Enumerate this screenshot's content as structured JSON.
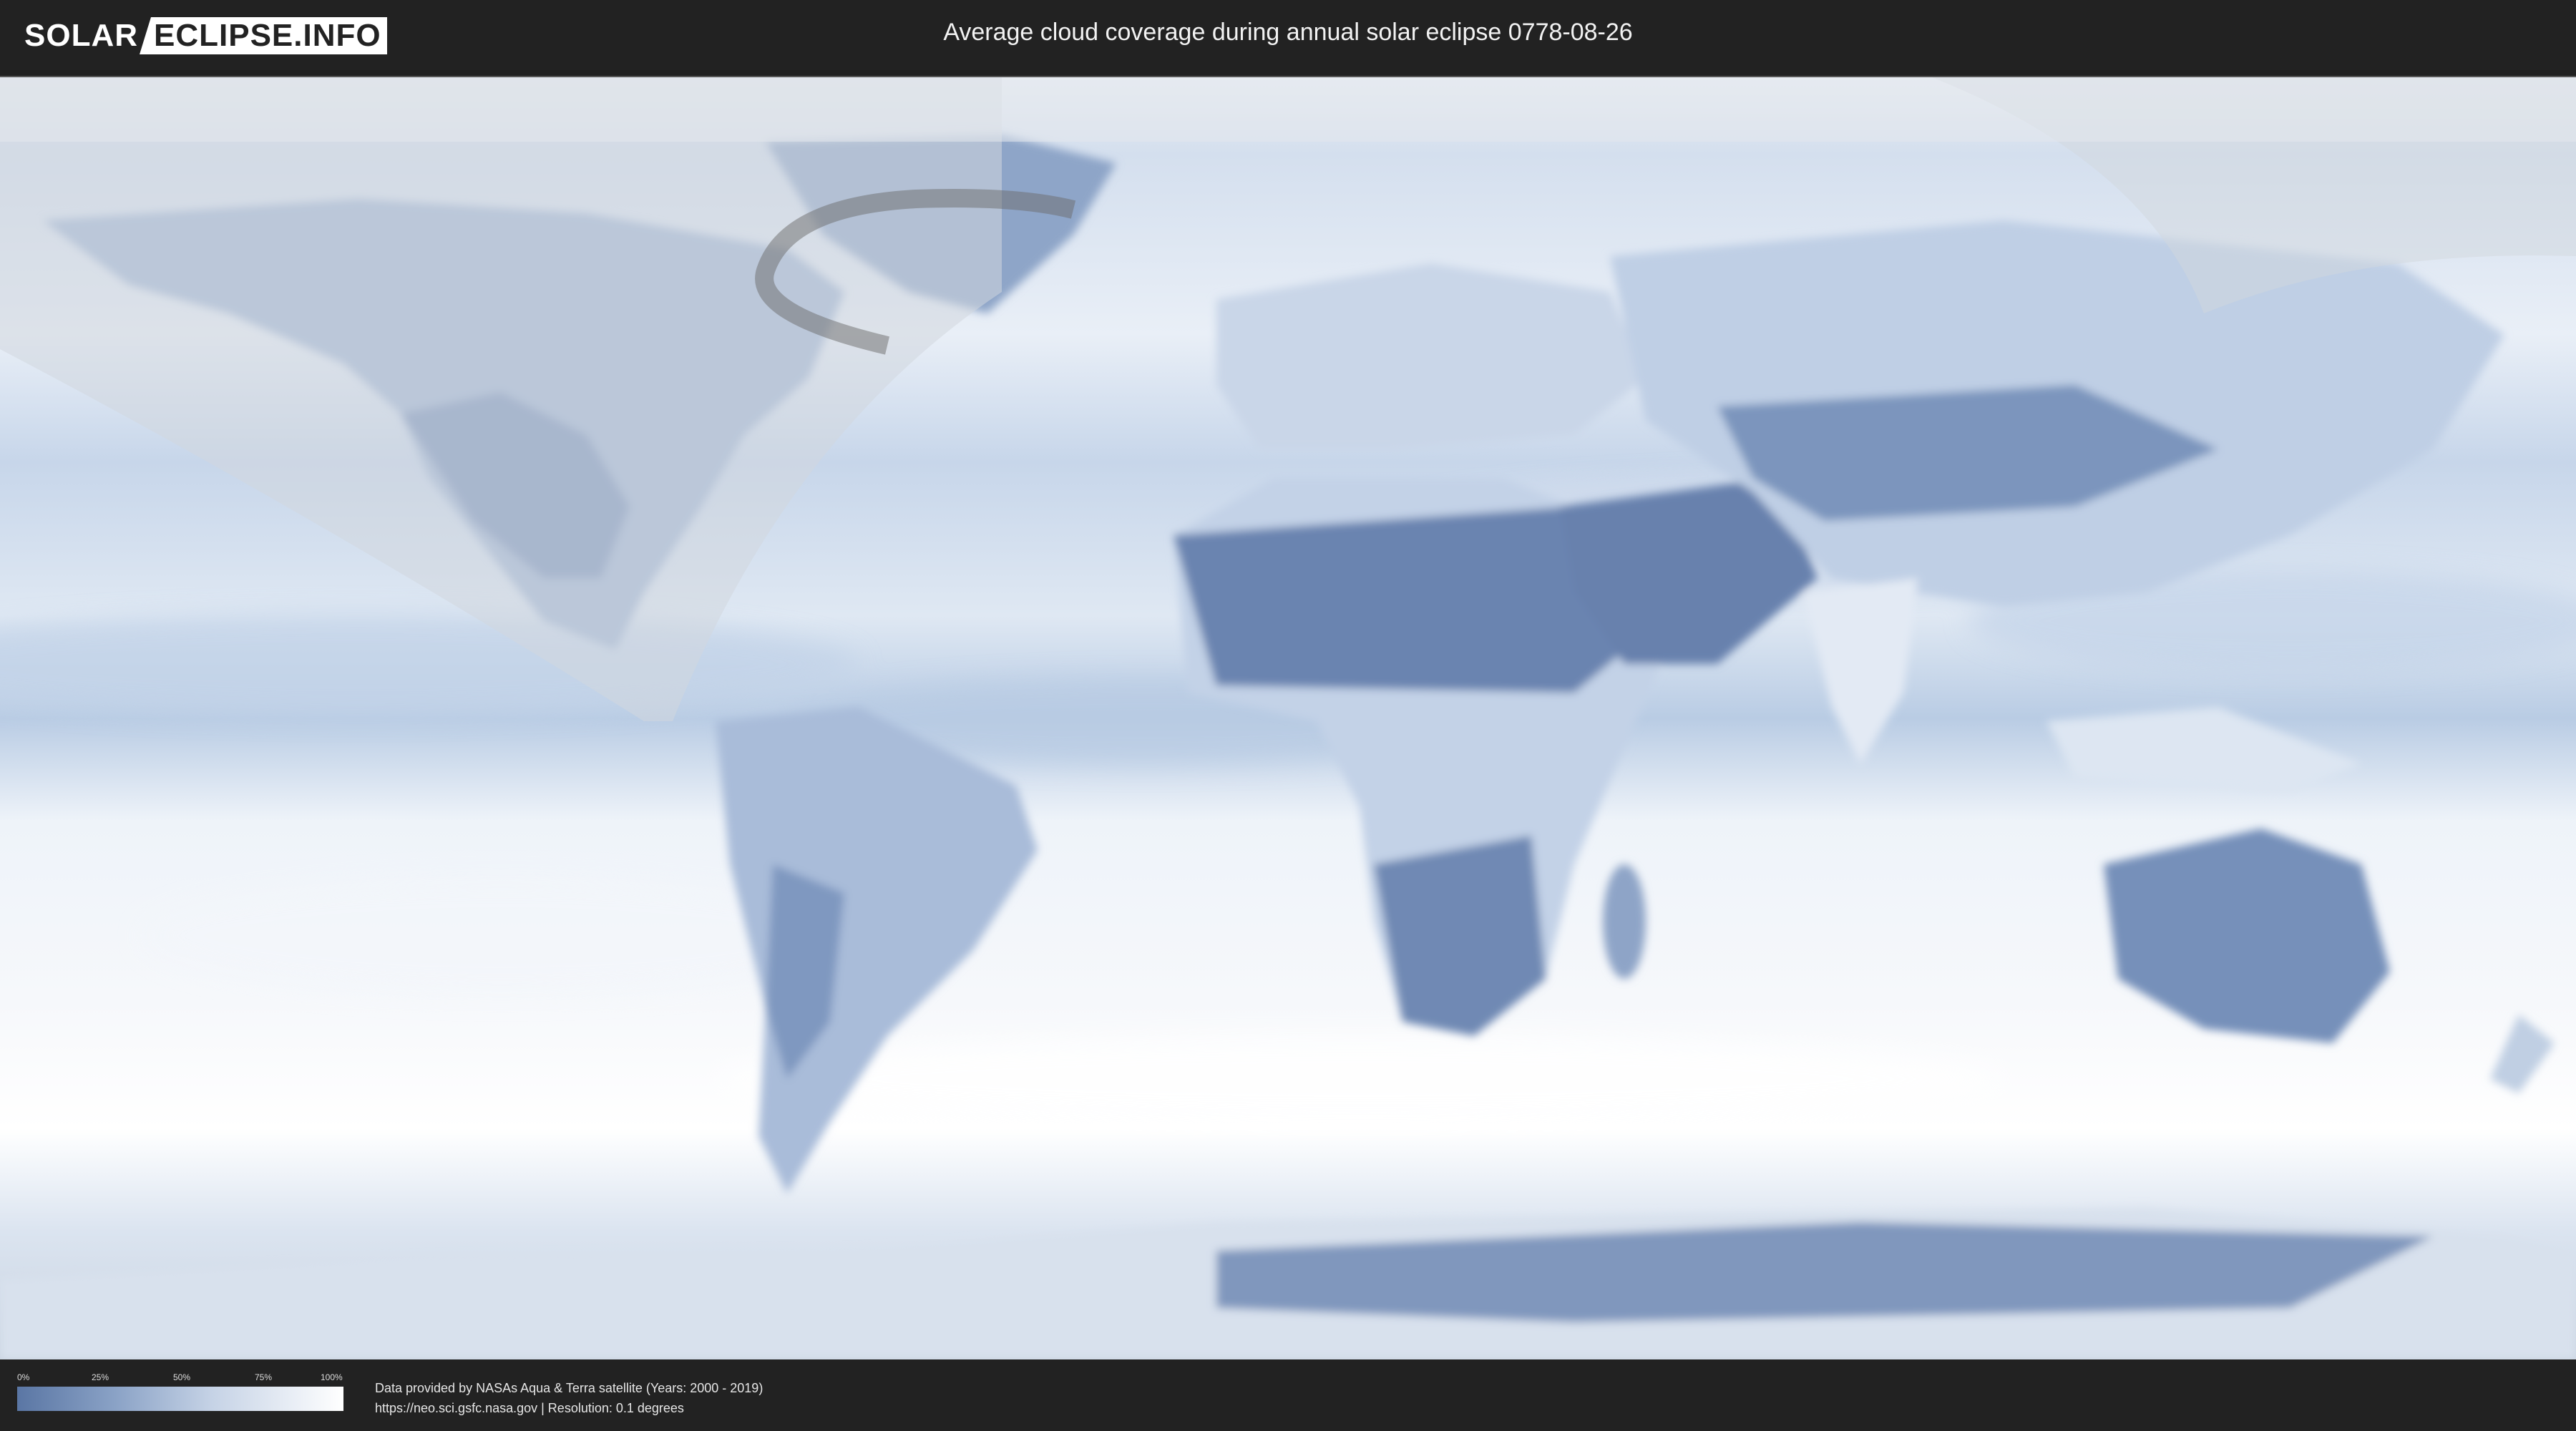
{
  "header": {
    "logo_left": "SOLAR",
    "logo_right": "ECLIPSE.INFO",
    "title": "Average cloud coverage during annual solar eclipse 0778-08-26"
  },
  "legend": {
    "ticks": [
      "0%",
      "25%",
      "50%",
      "75%",
      "100%"
    ],
    "tick_fractions": [
      0,
      0.25,
      0.5,
      0.75,
      1.0
    ],
    "color_low": "#5a76a4",
    "color_high": "#ffffff"
  },
  "footer": {
    "credit_line1": "Data provided by NASAs Aqua & Terra satellite (Years: 2000 - 2019)",
    "credit_line2": "https://neo.sci.gsfc.nasa.gov | Resolution: 0.1 degrees"
  },
  "map": {
    "ocean_color": "#dbe5f1",
    "land_clear_color": "#6d87b2",
    "cloudy_color": "#f4f7fb",
    "night_shade_color": "#cfd5dc"
  }
}
